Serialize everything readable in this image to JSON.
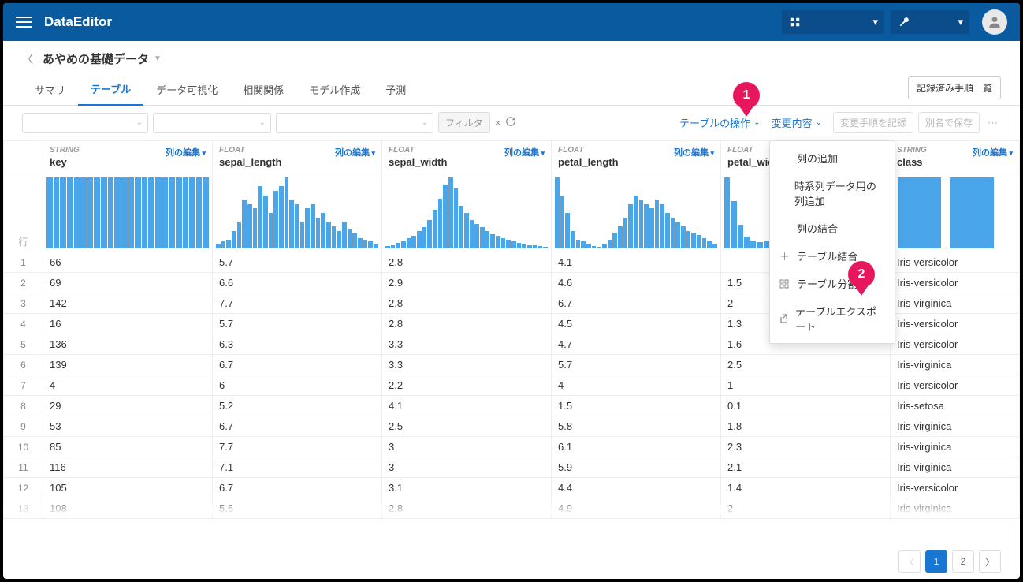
{
  "app": {
    "title": "DataEditor"
  },
  "page": {
    "title": "あやめの基礎データ"
  },
  "tabs": {
    "summary": "サマリ",
    "table": "テーブル",
    "viz": "データ可視化",
    "corr": "相関関係",
    "model": "モデル作成",
    "predict": "予測"
  },
  "buttons": {
    "recorded_list": "記録済み手順一覧",
    "filter": "フィルタ",
    "record_change": "変更手順を記録",
    "save_as": "別名で保存"
  },
  "actions": {
    "table_ops": "テーブルの操作",
    "changes": "変更内容"
  },
  "menu": {
    "add_column": "列の追加",
    "add_ts_column": "時系列データ用の列追加",
    "merge_columns": "列の結合",
    "join_table": "テーブル結合",
    "split_table": "テーブル分割",
    "export_table": "テーブルエクスポート"
  },
  "row_label": "行",
  "col_edit_label": "列の編集",
  "columns": [
    {
      "type": "STRING",
      "name": "key"
    },
    {
      "type": "FLOAT",
      "name": "sepal_length"
    },
    {
      "type": "FLOAT",
      "name": "sepal_width"
    },
    {
      "type": "FLOAT",
      "name": "petal_length"
    },
    {
      "type": "FLOAT",
      "name": "petal_width"
    },
    {
      "type": "STRING",
      "name": "class"
    }
  ],
  "chart_data": [
    {
      "type": "bar",
      "column": "key",
      "values": [
        100,
        100,
        100,
        100,
        100,
        100,
        100,
        100,
        100,
        100,
        100,
        100,
        100,
        100,
        100,
        100,
        100,
        100,
        100,
        100,
        100,
        100,
        100,
        100
      ]
    },
    {
      "type": "bar",
      "column": "sepal_length",
      "values": [
        5,
        8,
        10,
        20,
        30,
        55,
        50,
        45,
        70,
        60,
        40,
        65,
        70,
        80,
        55,
        50,
        30,
        45,
        50,
        35,
        40,
        30,
        25,
        20,
        30,
        22,
        18,
        12,
        10,
        8,
        5
      ]
    },
    {
      "type": "bar",
      "column": "sepal_width",
      "values": [
        3,
        5,
        8,
        10,
        14,
        18,
        25,
        30,
        40,
        55,
        70,
        90,
        100,
        85,
        60,
        50,
        40,
        35,
        30,
        25,
        20,
        18,
        15,
        12,
        10,
        8,
        6,
        5,
        4,
        3,
        2
      ]
    },
    {
      "type": "bar",
      "column": "petal_length",
      "values": [
        80,
        60,
        40,
        20,
        10,
        8,
        5,
        3,
        2,
        5,
        10,
        18,
        25,
        35,
        50,
        60,
        55,
        50,
        45,
        55,
        50,
        40,
        35,
        30,
        25,
        20,
        18,
        15,
        12,
        8,
        5
      ]
    },
    {
      "type": "bar",
      "column": "petal_width",
      "values": [
        90,
        60,
        30,
        15,
        10,
        8,
        10,
        15,
        20,
        30,
        40,
        45,
        50,
        55,
        50,
        45,
        40,
        35,
        30,
        25,
        20,
        18,
        15,
        12,
        10
      ]
    },
    {
      "type": "bar",
      "column": "class",
      "values": [
        100,
        100
      ]
    }
  ],
  "rows": [
    {
      "idx": "1",
      "key": "66",
      "sepal_length": "5.7",
      "sepal_width": "2.8",
      "petal_length": "4.1",
      "petal_width": "",
      "class": "Iris-versicolor"
    },
    {
      "idx": "2",
      "key": "69",
      "sepal_length": "6.6",
      "sepal_width": "2.9",
      "petal_length": "4.6",
      "petal_width": "1.5",
      "class": "Iris-versicolor"
    },
    {
      "idx": "3",
      "key": "142",
      "sepal_length": "7.7",
      "sepal_width": "2.8",
      "petal_length": "6.7",
      "petal_width": "2",
      "class": "Iris-virginica"
    },
    {
      "idx": "4",
      "key": "16",
      "sepal_length": "5.7",
      "sepal_width": "2.8",
      "petal_length": "4.5",
      "petal_width": "1.3",
      "class": "Iris-versicolor"
    },
    {
      "idx": "5",
      "key": "136",
      "sepal_length": "6.3",
      "sepal_width": "3.3",
      "petal_length": "4.7",
      "petal_width": "1.6",
      "class": "Iris-versicolor"
    },
    {
      "idx": "6",
      "key": "139",
      "sepal_length": "6.7",
      "sepal_width": "3.3",
      "petal_length": "5.7",
      "petal_width": "2.5",
      "class": "Iris-virginica"
    },
    {
      "idx": "7",
      "key": "4",
      "sepal_length": "6",
      "sepal_width": "2.2",
      "petal_length": "4",
      "petal_width": "1",
      "class": "Iris-versicolor"
    },
    {
      "idx": "8",
      "key": "29",
      "sepal_length": "5.2",
      "sepal_width": "4.1",
      "petal_length": "1.5",
      "petal_width": "0.1",
      "class": "Iris-setosa"
    },
    {
      "idx": "9",
      "key": "53",
      "sepal_length": "6.7",
      "sepal_width": "2.5",
      "petal_length": "5.8",
      "petal_width": "1.8",
      "class": "Iris-virginica"
    },
    {
      "idx": "10",
      "key": "85",
      "sepal_length": "7.7",
      "sepal_width": "3",
      "petal_length": "6.1",
      "petal_width": "2.3",
      "class": "Iris-virginica"
    },
    {
      "idx": "11",
      "key": "116",
      "sepal_length": "7.1",
      "sepal_width": "3",
      "petal_length": "5.9",
      "petal_width": "2.1",
      "class": "Iris-virginica"
    },
    {
      "idx": "12",
      "key": "105",
      "sepal_length": "6.7",
      "sepal_width": "3.1",
      "petal_length": "4.4",
      "petal_width": "1.4",
      "class": "Iris-versicolor"
    },
    {
      "idx": "13",
      "key": "108",
      "sepal_length": "5.6",
      "sepal_width": "2.8",
      "petal_length": "4.9",
      "petal_width": "2",
      "class": "Iris-virginica"
    }
  ],
  "pager": {
    "pages": [
      "1",
      "2"
    ],
    "current": "1"
  },
  "callouts": {
    "pin1": "1",
    "pin2": "2"
  }
}
